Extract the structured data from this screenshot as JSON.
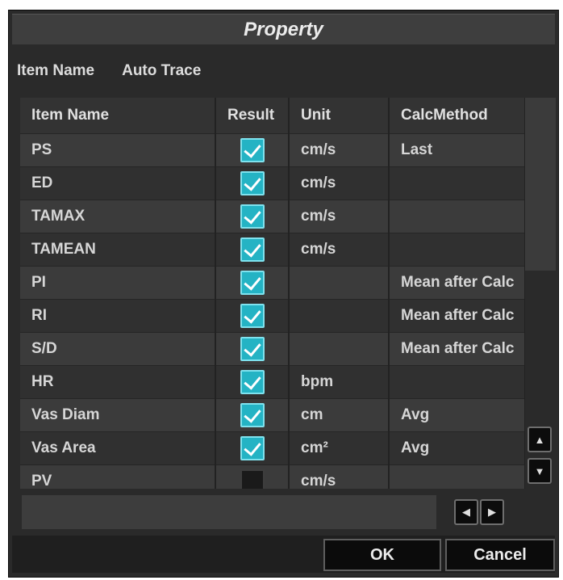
{
  "dialog": {
    "title": "Property"
  },
  "item": {
    "label": "Item Name",
    "value": "Auto Trace"
  },
  "table": {
    "headers": [
      "Item Name",
      "Result",
      "Unit",
      "CalcMethod"
    ],
    "rows": [
      {
        "name": "PS",
        "checked": true,
        "unit": "cm/s",
        "calc": "Last"
      },
      {
        "name": "ED",
        "checked": true,
        "unit": "cm/s",
        "calc": ""
      },
      {
        "name": "TAMAX",
        "checked": true,
        "unit": "cm/s",
        "calc": ""
      },
      {
        "name": "TAMEAN",
        "checked": true,
        "unit": "cm/s",
        "calc": ""
      },
      {
        "name": "PI",
        "checked": true,
        "unit": "",
        "calc": "Mean after Calc"
      },
      {
        "name": "RI",
        "checked": true,
        "unit": "",
        "calc": "Mean after Calc"
      },
      {
        "name": "S/D",
        "checked": true,
        "unit": "",
        "calc": "Mean after Calc"
      },
      {
        "name": "HR",
        "checked": true,
        "unit": "bpm",
        "calc": ""
      },
      {
        "name": "Vas Diam",
        "checked": true,
        "unit": "cm",
        "calc": "Avg"
      },
      {
        "name": "Vas Area",
        "checked": true,
        "unit": "cm²",
        "calc": "Avg"
      },
      {
        "name": "PV",
        "checked": false,
        "unit": "cm/s",
        "calc": ""
      }
    ]
  },
  "scroll": {
    "up": "▲",
    "down": "▼",
    "left": "◀",
    "right": "▶"
  },
  "buttons": {
    "ok": "OK",
    "cancel": "Cancel"
  },
  "colors": {
    "checkbox_on": "#24b3c4",
    "dialog_bg": "#2a2a2a",
    "row_odd": "#3b3b3b",
    "row_even": "#303030"
  }
}
